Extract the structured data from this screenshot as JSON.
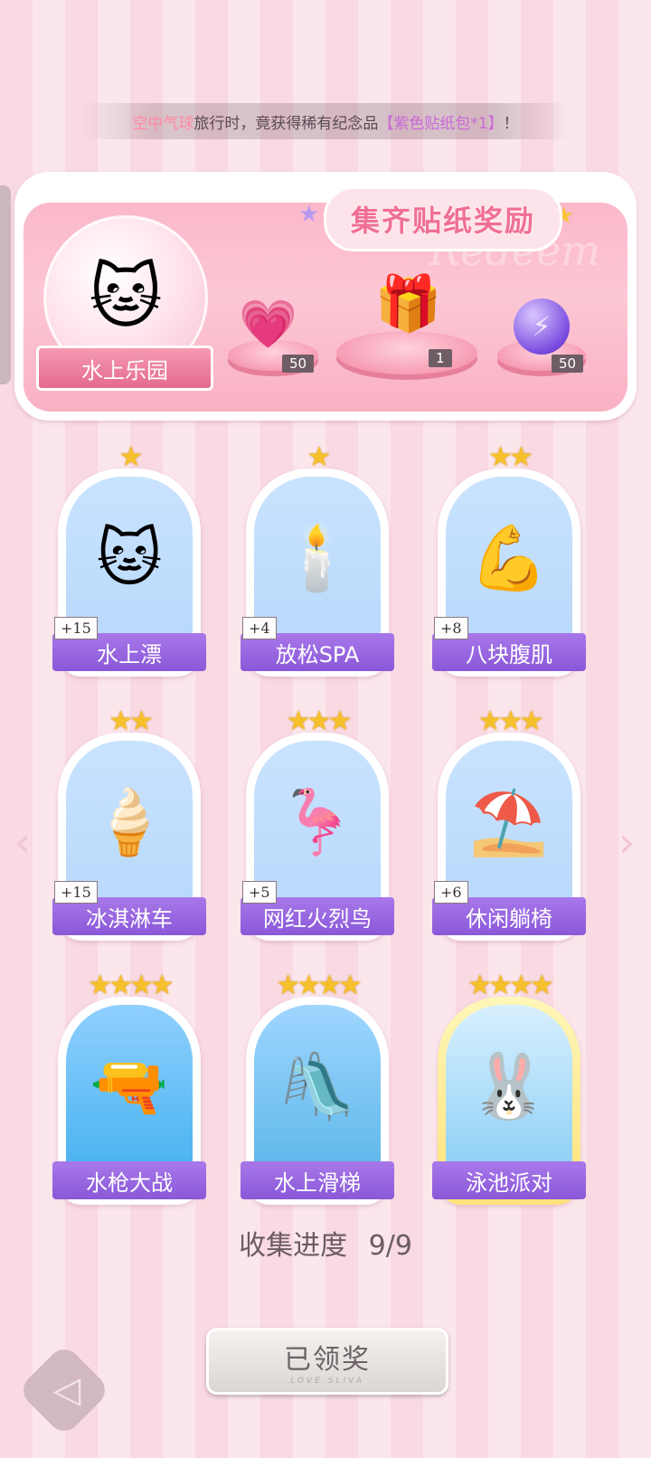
{
  "notice": {
    "prefix": "空中气球",
    "middle": "旅行时，竟获得稀有纪念品",
    "item": "【紫色贴纸包*1】",
    "suffix": "！"
  },
  "reward_panel": {
    "title": "集齐贴纸奖励",
    "watermark": "Redeem",
    "theme_name": "水上乐园",
    "rewards": [
      {
        "icon": "heart-gem-icon",
        "count": "50"
      },
      {
        "icon": "sticker-box-icon",
        "count": "1"
      },
      {
        "icon": "lightning-orb-icon",
        "count": "50"
      }
    ]
  },
  "cards": [
    {
      "name": "水上漂",
      "stars": "★",
      "plus": "+15",
      "icon": "cat-float-icon",
      "emoji": "🐱"
    },
    {
      "name": "放松SPA",
      "stars": "★",
      "plus": "+4",
      "icon": "aroma-candle-icon",
      "emoji": "🕯️"
    },
    {
      "name": "八块腹肌",
      "stars": "★★",
      "plus": "+8",
      "icon": "muscle-cat-icon",
      "emoji": "💪"
    },
    {
      "name": "冰淇淋车",
      "stars": "★★",
      "plus": "+15",
      "icon": "ice-cream-truck-icon",
      "emoji": "🍦"
    },
    {
      "name": "网红火烈鸟",
      "stars": "★★★",
      "plus": "+5",
      "icon": "flamingo-float-icon",
      "emoji": "🦩"
    },
    {
      "name": "休闲躺椅",
      "stars": "★★★",
      "plus": "+6",
      "icon": "beach-chair-icon",
      "emoji": "⛱️"
    },
    {
      "name": "水枪大战",
      "stars": "★★★★",
      "plus": "",
      "icon": "water-gun-icon",
      "emoji": "🔫"
    },
    {
      "name": "水上滑梯",
      "stars": "★★★★",
      "plus": "",
      "icon": "water-slide-icon",
      "emoji": "🛝"
    },
    {
      "name": "泳池派对",
      "stars": "★★★★",
      "plus": "",
      "icon": "pool-party-icon",
      "emoji": "🐰"
    }
  ],
  "progress": {
    "label": "收集进度",
    "value": "9/9"
  },
  "claimed_button": {
    "label": "已领奖",
    "sub": "LOVE SLIVA"
  },
  "nav": {
    "prev_arrow": "‹",
    "next_arrow": "›",
    "back_icon": "◁"
  }
}
